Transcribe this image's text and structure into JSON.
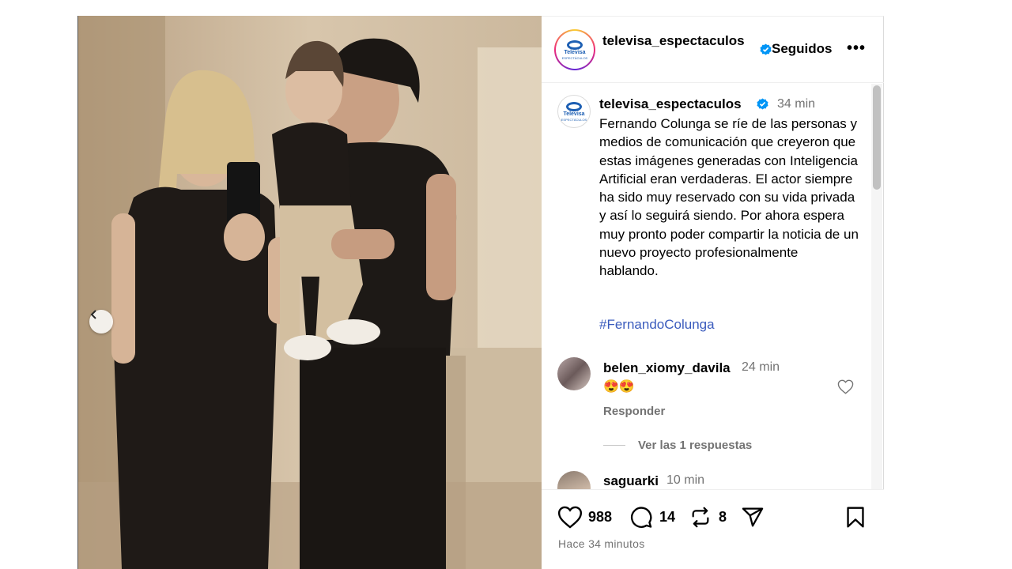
{
  "post": {
    "username": "televisa_espectaculos",
    "follow_label": "Seguidos",
    "more_label": "•••",
    "logo_text": "Televisa",
    "logo_sub": "ESPECTÁCULOS"
  },
  "caption": {
    "username": "televisa_espectaculos",
    "time": "34 min",
    "text": "Fernando Colunga se ríe de las personas y medios de comunicación que creyeron que estas imágenes generadas con Inteligencia Artificial eran verdaderas. El actor siempre ha sido muy reservado con su vida privada y así lo seguirá siendo. Por ahora espera muy pronto poder compartir la noticia de un nuevo proyecto profesionalmente hablando.",
    "hashtag": "#FernandoColunga"
  },
  "comments": [
    {
      "username": "belen_xiomy_davila",
      "time": "24 min",
      "text": "😍😍",
      "reply_label": "Responder",
      "view_replies_label": "Ver las 1 respuestas"
    },
    {
      "username": "saguarki",
      "time": "10 min"
    }
  ],
  "stats": {
    "likes": "988",
    "comments": "14",
    "reposts": "8",
    "posted_ago": "Hace 34 minutos"
  },
  "colors": {
    "verified": "#0095f6",
    "hashtag": "#3a5bbd",
    "muted": "#737373"
  }
}
